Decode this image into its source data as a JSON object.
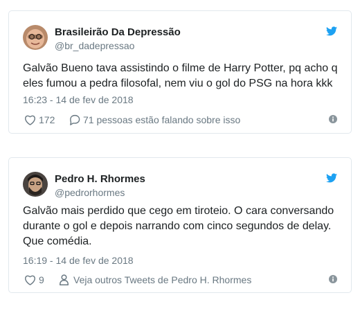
{
  "colors": {
    "text": "#1c2022",
    "secondary": "#697882",
    "border": "#e1e8ed",
    "twitter_blue": "#1da1f2"
  },
  "tweets": [
    {
      "name": "Brasileirão Da Depressão",
      "handle": "@br_dadepressao",
      "text_lines": [
        "Galvão Bueno tava assistindo o filme de Harry Potter, pq acho q",
        "eles fumou a pedra filosofal, nem viu o gol do PSG na hora kkk"
      ],
      "date": "16:23 - 14 de fev de 2018",
      "likes": "172",
      "reply_text": "71 pessoas estão falando sobre isso",
      "icons": [
        "heart-icon",
        "reply-bubble-icon",
        "info-icon",
        "twitter-bird-icon"
      ]
    },
    {
      "name": "Pedro H. Rhormes",
      "handle": "@pedrorhormes",
      "text_lines": [
        "Galvão mais perdido que cego em tiroteio. O cara conversando",
        "durante o gol e depois narrando com cinco segundos de delay.",
        "Que comédia."
      ],
      "date": "16:19 - 14 de fev de 2018",
      "likes": "9",
      "profile_text": "Veja outros Tweets de Pedro H. Rhormes",
      "icons": [
        "heart-icon",
        "person-icon",
        "info-icon",
        "twitter-bird-icon"
      ]
    }
  ]
}
